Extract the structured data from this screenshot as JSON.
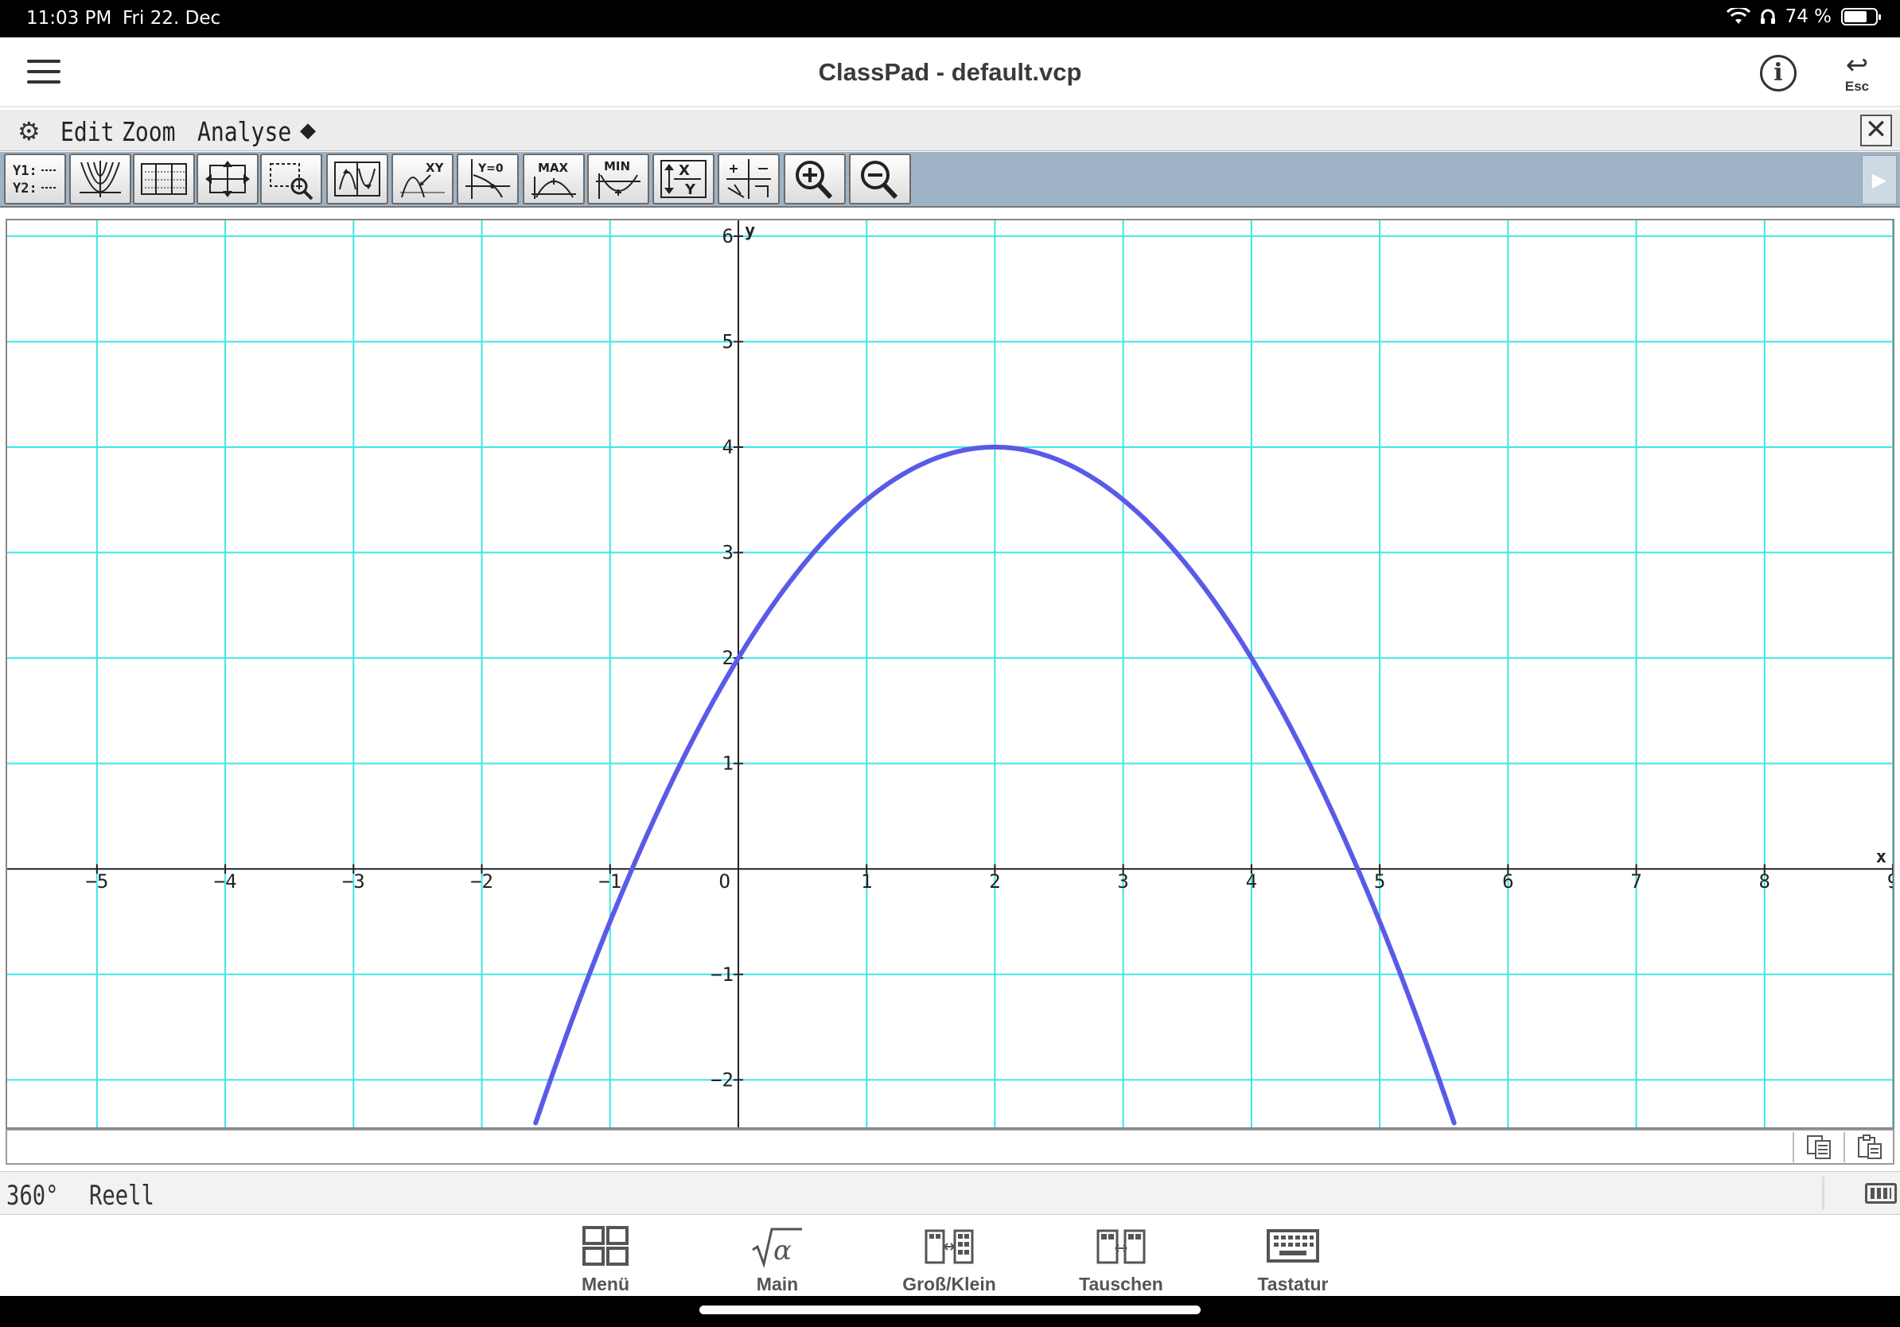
{
  "status_bar": {
    "time": "11:03 PM",
    "date": "Fri 22. Dec",
    "battery_percent": "74 %",
    "icons": [
      "wifi-icon",
      "headphones-icon",
      "battery-icon"
    ]
  },
  "header": {
    "title": "ClassPad - default.vcp",
    "esc_label": "Esc"
  },
  "menu": {
    "items": [
      "Edit",
      "Zoom",
      "Analyse"
    ]
  },
  "toolbar": {
    "buttons": [
      {
        "icon": "graph-editor-icon",
        "label": "Y1:… Y2:…"
      },
      {
        "icon": "graph-window-icon"
      },
      {
        "icon": "table-icon"
      },
      {
        "icon": "view-window-icon"
      },
      {
        "icon": "zoom-box-icon"
      },
      {
        "icon": "pan-icon"
      },
      {
        "icon": "trace-xy-icon",
        "label": "XY"
      },
      {
        "icon": "root-icon",
        "label": "Y=0"
      },
      {
        "icon": "max-icon",
        "label": "MAX"
      },
      {
        "icon": "min-icon",
        "label": "MIN"
      },
      {
        "icon": "swap-xy-icon",
        "label": "X Y"
      },
      {
        "icon": "intersect-icon"
      },
      {
        "icon": "zoom-in-icon"
      },
      {
        "icon": "zoom-out-icon"
      }
    ]
  },
  "chart_data": {
    "type": "line",
    "function": "y = -0.5(x-2)^2 + 4",
    "xlim": [
      -5.7,
      9.0
    ],
    "ylim": [
      -2.45,
      6.15
    ],
    "x_ticks": [
      -5,
      -4,
      -3,
      -2,
      -1,
      0,
      1,
      2,
      3,
      4,
      5,
      6,
      7,
      8,
      9
    ],
    "x_tick_labels": [
      "−5",
      "−4",
      "−3",
      "−2",
      "−1",
      "O",
      "1",
      "2",
      "3",
      "4",
      "5",
      "6",
      "7",
      "8",
      "9"
    ],
    "y_ticks": [
      -2,
      -1,
      1,
      2,
      3,
      4,
      5,
      6
    ],
    "y_tick_labels": [
      "−2",
      "−1",
      "1",
      "2",
      "3",
      "4",
      "5",
      "6"
    ],
    "xlabel": "x",
    "ylabel": "y",
    "grid": true,
    "grid_color": "#3ee6e6",
    "series": [
      {
        "color": "#5a5ae8",
        "x": [
          -1.58,
          -1.0,
          0,
          1,
          2,
          3,
          4,
          5,
          5.58
        ],
        "y": [
          -2.41,
          -0.5,
          2,
          3.5,
          4,
          3.5,
          2,
          -0.5,
          -2.41
        ]
      }
    ]
  },
  "status_line": {
    "angle": "360°",
    "mode": "Reell"
  },
  "dock": {
    "items": [
      {
        "icon": "menu-grid-icon",
        "label": "Menü"
      },
      {
        "icon": "main-sqrt-alpha-icon",
        "label": "Main"
      },
      {
        "icon": "size-toggle-icon",
        "label": "Groß/Klein"
      },
      {
        "icon": "swap-icon",
        "label": "Tauschen"
      },
      {
        "icon": "keyboard-icon",
        "label": "Tastatur"
      }
    ]
  }
}
